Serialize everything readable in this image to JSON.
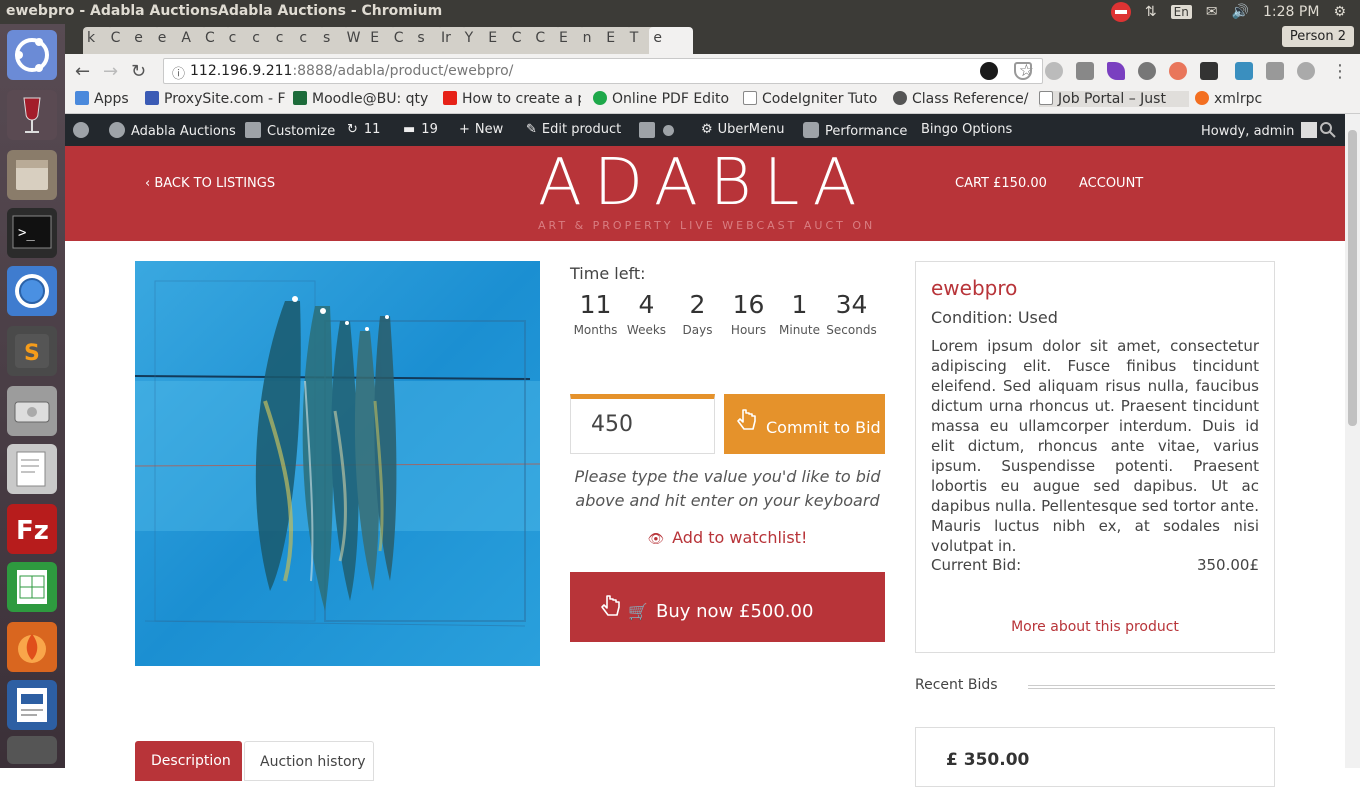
{
  "os": {
    "window_title": "ewebpro - Adabla AuctionsAdabla Auctions - Chromium",
    "language": "En",
    "clock": "1:28 PM"
  },
  "browser": {
    "tab_letters": [
      "k",
      "C",
      "e",
      "e",
      "A",
      "C",
      "c",
      "c",
      "c",
      "c",
      "s",
      "W",
      "E",
      "C",
      "s",
      "Ir",
      "Y",
      "E",
      "C",
      "C",
      "E",
      "n",
      "E",
      "T",
      "e"
    ],
    "person": "Person 2",
    "url_host": "112.196.9.211",
    "url_path": ":8888/adabla/product/ewebpro/",
    "bookmarks": [
      {
        "label": "Apps",
        "color": "#4a89dc"
      },
      {
        "label": "ProxySite.com - F",
        "color": "#3b5bb5"
      },
      {
        "label": "Moodle@BU: qty",
        "color": "#1d6b3a"
      },
      {
        "label": "How to create a p",
        "color": "#e62117"
      },
      {
        "label": "Online PDF Edito",
        "color": "#1ea84a"
      },
      {
        "label": "CodeIgniter Tuto",
        "color": "#888888"
      },
      {
        "label": "Class Reference/",
        "color": "#555555"
      },
      {
        "label": "Job Portal – Just",
        "color": "#888888"
      },
      {
        "label": "xmlrpc",
        "color": "#f36f21"
      }
    ]
  },
  "wp_admin_bar": {
    "site": "Adabla Auctions",
    "customize": "Customize",
    "updates": "11",
    "comments": "19",
    "new": "New",
    "edit": "Edit product",
    "ubermenu": "UberMenu",
    "performance": "Performance",
    "bingo": "Bingo Options",
    "howdy": "Howdy, admin"
  },
  "header": {
    "back": "‹ BACK TO LISTINGS",
    "logo": "ADABLA",
    "tagline": "ART & PROPERTY LIVE WEBCAST AUCT ON",
    "cart": "CART £150.00",
    "account": "ACCOUNT"
  },
  "countdown": {
    "label": "Time left:",
    "units": [
      {
        "n": "11",
        "u": "Months"
      },
      {
        "n": "4",
        "u": "Weeks"
      },
      {
        "n": "2",
        "u": "Days"
      },
      {
        "n": "16",
        "u": "Hours"
      },
      {
        "n": "1",
        "u": "Minute"
      },
      {
        "n": "34",
        "u": "Seconds"
      }
    ]
  },
  "bid": {
    "value": "450",
    "commit": "Commit to Bid",
    "hint": "Please type the value you'd like to bid above and hit enter on your keyboard",
    "watchlist": "Add to watchlist!",
    "buy_now": "Buy now £500.00"
  },
  "product": {
    "name": "ewebpro",
    "condition": "Condition: Used",
    "description": "Lorem ipsum dolor sit amet, consectetur adipiscing elit. Fusce finibus tincidunt eleifend. Sed aliquam risus nulla, faucibus dictum urna rhoncus ut. Praesent tincidunt massa eu ullamcorper interdum. Duis id elit dictum, rhoncus ante vitae, varius ipsum. Suspendisse potenti. Praesent lobortis eu augue sed dapibus. Ut ac dapibus nulla. Pellentesque sed tortor ante. Mauris luctus nibh ex, at sodales nisi volutpat in.",
    "current_bid_label": "Current Bid:",
    "current_bid_value": "350.00£",
    "more": "More about this product"
  },
  "recent_bids": {
    "title": "Recent Bids",
    "first": "£ 350.00"
  },
  "tabs": {
    "description": "Description",
    "history": "Auction history"
  },
  "colors": {
    "brand_red": "#b83439",
    "bid_orange": "#e5922b",
    "wp_bar": "#23282d"
  }
}
